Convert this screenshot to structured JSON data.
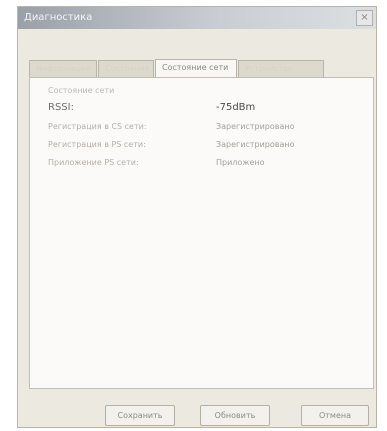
{
  "window": {
    "title": "Диагностика",
    "close_label": "×"
  },
  "tabs": [
    {
      "label": "Информация",
      "active": false
    },
    {
      "label": "Состояние",
      "active": false
    },
    {
      "label": "Состояние сети",
      "active": true
    },
    {
      "label": "Устройство",
      "active": false
    }
  ],
  "network": {
    "section_title": "Состояние сети",
    "rows": [
      {
        "label": "RSSI:",
        "value": "-75dBm"
      },
      {
        "label": "Регистрация в CS сети:",
        "value": "Зарегистрировано"
      },
      {
        "label": "Регистрация в PS сети:",
        "value": "Зарегистрировано"
      },
      {
        "label": "Приложение PS сети:",
        "value": "Приложено"
      }
    ]
  },
  "buttons": {
    "save": "Сохранить",
    "refresh": "Обновить",
    "cancel": "Отмена"
  }
}
